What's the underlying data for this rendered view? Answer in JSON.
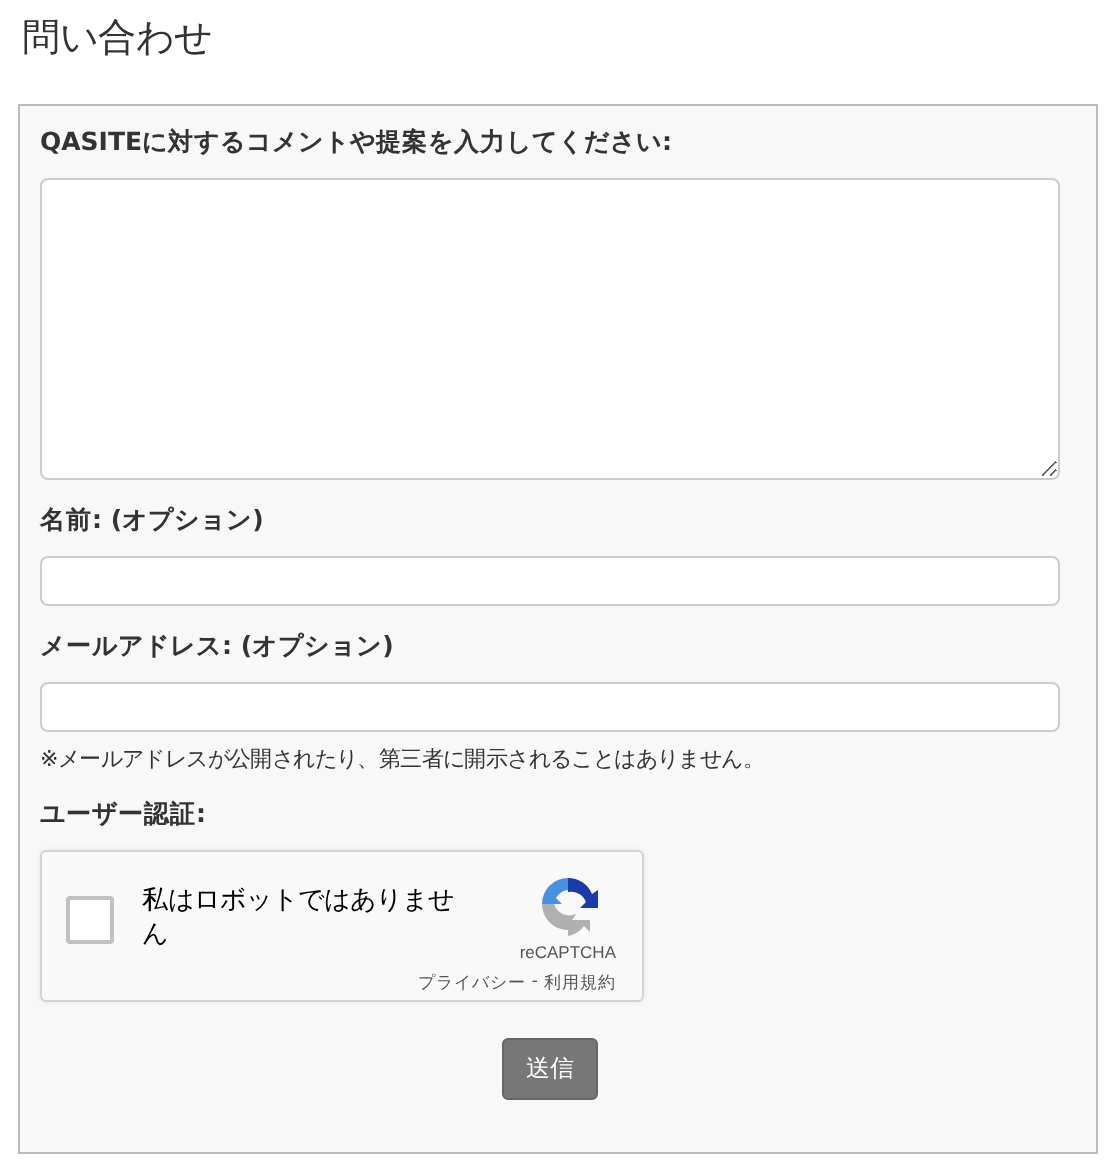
{
  "title": "問い合わせ",
  "form": {
    "fields": [
      {
        "kind": "textarea",
        "label": "QASITEに対するコメントや提案を入力してください:"
      },
      {
        "kind": "input",
        "label": "名前: (オプション)"
      },
      {
        "kind": "input",
        "label": "メールアドレス: (オプション)",
        "note": "※メールアドレスが公開されたり、第三者に開示されることはありません。"
      }
    ],
    "verification_label": "ユーザー認証:",
    "captcha": {
      "checked": false,
      "text": "私はロボットではありません",
      "brand": "reCAPTCHA",
      "privacy_link": "プライバシー",
      "separator": "-",
      "terms_link": "利用規約"
    },
    "submit": "送信"
  }
}
